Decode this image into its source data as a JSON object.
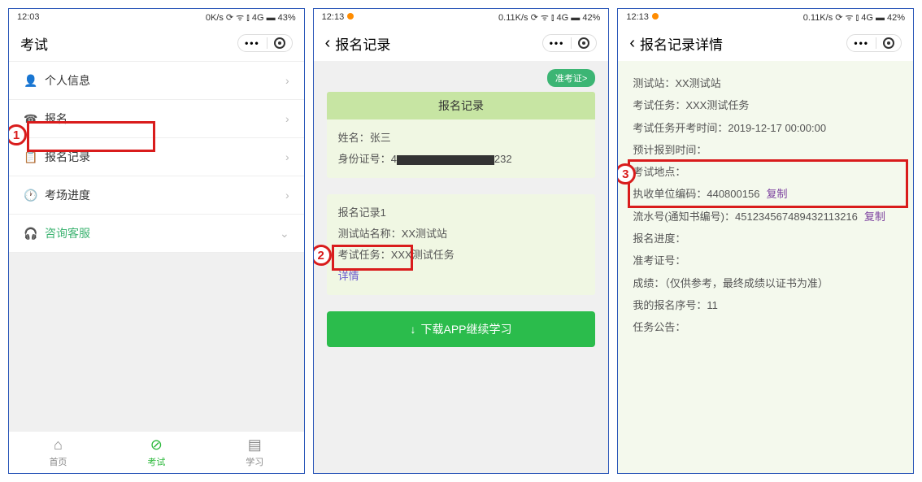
{
  "s1": {
    "status": {
      "time": "12:03",
      "right": "0K/s ⟳ ᯤ ⫾ 4G ▬ 43%"
    },
    "title": "考试",
    "menu": [
      {
        "icon": "👤",
        "label": "个人信息"
      },
      {
        "icon": "☎",
        "label": "报名"
      },
      {
        "icon": "📋",
        "label": "报名记录"
      },
      {
        "icon": "🕐",
        "label": "考场进度"
      },
      {
        "icon": "🎧",
        "label": "咨询客服",
        "chev": "⌄",
        "green": true
      }
    ],
    "tabs": [
      {
        "icon": "⌂",
        "label": "首页"
      },
      {
        "icon": "⊘",
        "label": "考试"
      },
      {
        "icon": "▤",
        "label": "学习"
      }
    ]
  },
  "s2": {
    "status": {
      "time": "12:13",
      "right": "0.11K/s ⟳ ᯤ ⫾ 4G ▬ 42%"
    },
    "title": "报名记录",
    "tag": "准考证>",
    "card_header": "报名记录",
    "name_label": "姓名：",
    "name_value": "张三",
    "id_label": "身份证号：",
    "id_prefix": "4",
    "id_suffix": "232",
    "rec_title": "报名记录1",
    "station_label": "测试站名称：",
    "station_value": "XX测试站",
    "task_label": "考试任务：",
    "task_value": "XXX测试任务",
    "detail_link": "详情",
    "download": "下载APP继续学习"
  },
  "s3": {
    "status": {
      "time": "12:13",
      "right": "0.11K/s ⟳ ᯤ ⫾ 4G ▬ 42%"
    },
    "title": "报名记录详情",
    "lines": {
      "station": "测试站：XX测试站",
      "task": "考试任务：XXX测试任务",
      "task_time": "考试任务开考时间：2019-12-17 00:00:00",
      "checkin": "预计报到时间：",
      "location": "考试地点：",
      "collect_code_label": "执收单位编码：",
      "collect_code": "440800156",
      "flow_label": "流水号(通知书编号)：",
      "flow": "451234567489432113216",
      "progress": "报名进度：",
      "ticket": "准考证号：",
      "score": "成绩：（仅供参考，最终成绩以证书为准）",
      "seq": "我的报名序号：11",
      "notice": "任务公告："
    },
    "copy": "复制"
  },
  "anno": {
    "n1": "1",
    "n2": "2",
    "n3": "3"
  }
}
